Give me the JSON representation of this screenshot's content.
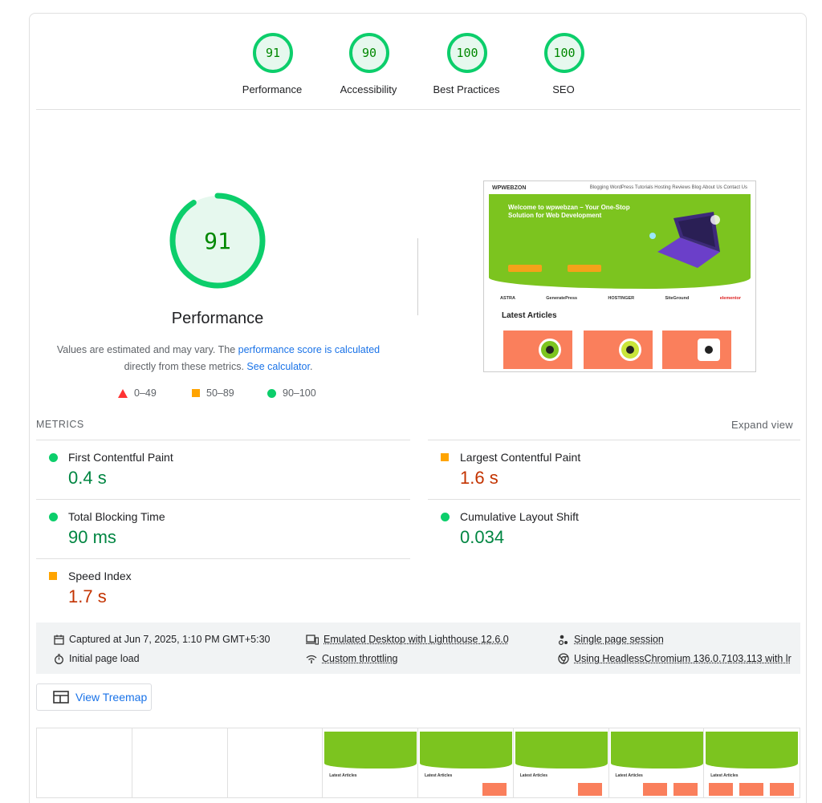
{
  "categories": [
    {
      "label": "Performance",
      "score": "91"
    },
    {
      "label": "Accessibility",
      "score": "90"
    },
    {
      "label": "Best Practices",
      "score": "100"
    },
    {
      "label": "SEO",
      "score": "100"
    }
  ],
  "main": {
    "score": "91",
    "title": "Performance",
    "desc_prefix": "Values are estimated and may vary. The ",
    "desc_link1": "performance score is calculated",
    "desc_middle": " directly from these metrics. ",
    "desc_link2": "See calculator",
    "desc_suffix": ".",
    "legend": {
      "fail": "0–49",
      "average": "50–89",
      "pass": "90–100"
    }
  },
  "screenshot": {
    "logo": "WPWEBZON",
    "nav": "Blogging   WordPress Tutorials   Hosting   Reviews   Blog   About Us   Contact Us",
    "hero_title": "Welcome to wpwebzan – Your One-Stop Solution for Web Development",
    "logos": [
      "ASTRA",
      "GeneratePress",
      "HOSTINGER",
      "SiteGround",
      "elementor"
    ],
    "latest": "Latest Articles"
  },
  "metrics": {
    "header": "METRICS",
    "expand": "Expand view",
    "items": [
      {
        "name": "First Contentful Paint",
        "value": "0.4 s",
        "rating": "pass"
      },
      {
        "name": "Largest Contentful Paint",
        "value": "1.6 s",
        "rating": "average"
      },
      {
        "name": "Total Blocking Time",
        "value": "90 ms",
        "rating": "pass"
      },
      {
        "name": "Cumulative Layout Shift",
        "value": "0.034",
        "rating": "pass"
      },
      {
        "name": "Speed Index",
        "value": "1.7 s",
        "rating": "average"
      }
    ]
  },
  "info": {
    "captured": "Captured at Jun 7, 2025, 1:10 PM GMT+5:30",
    "load": "Initial page load",
    "emulated": "Emulated Desktop with Lighthouse 12.6.0",
    "throttling": "Custom throttling",
    "session": "Single page session",
    "browser": "Using HeadlessChromium 136.0.7103.113 with lr"
  },
  "treemap": "View Treemap",
  "filmstrip": {
    "latest": "Latest Articles"
  },
  "colors": {
    "pass": "#0cce6b",
    "average": "#ffa400",
    "fail": "#ff3333",
    "link": "#1a73e8"
  }
}
